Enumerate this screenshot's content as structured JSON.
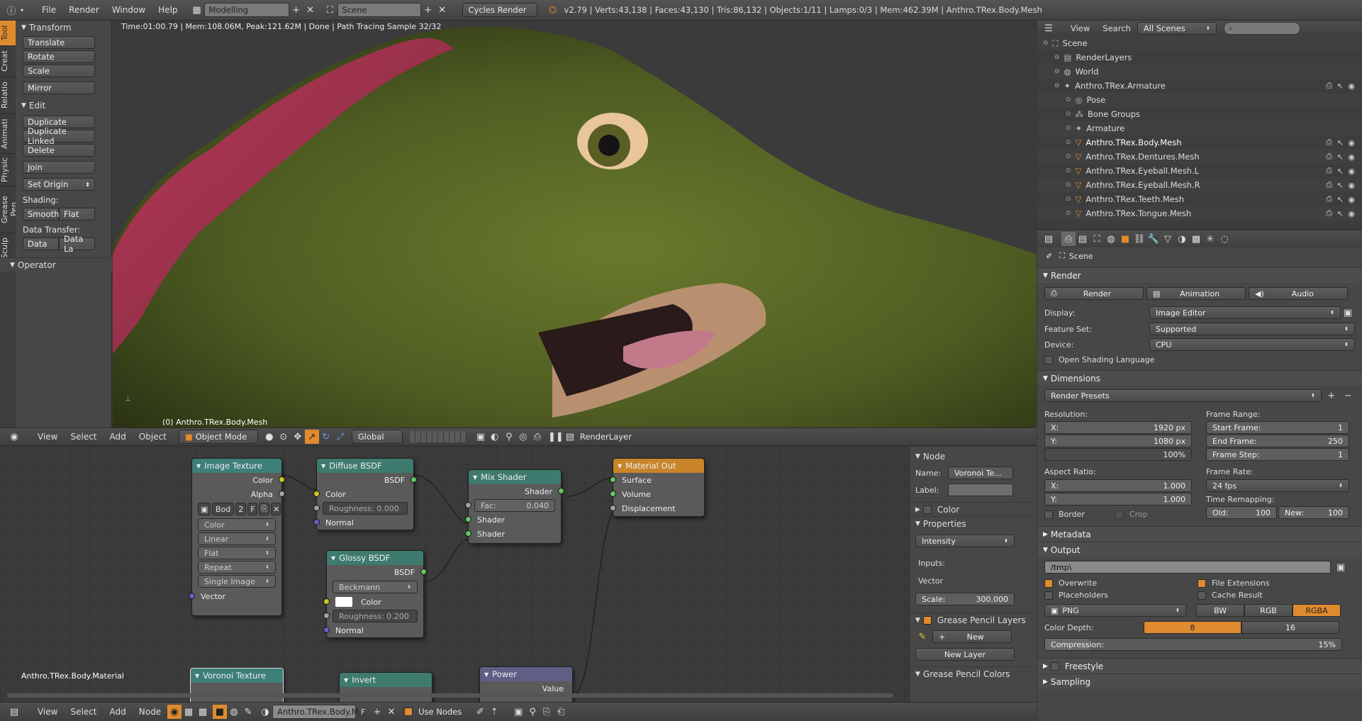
{
  "topbar": {
    "menus": [
      "File",
      "Render",
      "Window",
      "Help"
    ],
    "layout": "Modelling",
    "scene": "Scene",
    "engine": "Cycles Render",
    "stats": "v2.79 | Verts:43,138 | Faces:43,130 | Tris:86,132 | Objects:1/11 | Lamps:0/3 | Mem:462.39M | Anthro.TRex.Body.Mesh"
  },
  "toolshelf": {
    "tabs": [
      "Tool",
      "Creat",
      "Relatio",
      "Animati",
      "Physic",
      "Grease Pen",
      "Sculp"
    ],
    "transform_title": "Transform",
    "transform": [
      "Translate",
      "Rotate",
      "Scale",
      "Mirror"
    ],
    "edit_title": "Edit",
    "edit": [
      "Duplicate",
      "Duplicate Linked",
      "Delete",
      "Join"
    ],
    "set_origin": "Set Origin",
    "shading_label": "Shading:",
    "smooth": "Smooth",
    "flat": "Flat",
    "data_transfer_label": "Data Transfer:",
    "data": "Data",
    "data_la": "Data La",
    "operator": "Operator"
  },
  "viewport": {
    "render_status": "Time:01:00.79 | Mem:108.06M, Peak:121.62M | Done | Path Tracing Sample 32/32",
    "object_label": "(0) Anthro.TRex.Body.Mesh"
  },
  "vpheader": {
    "menus": [
      "View",
      "Select",
      "Add",
      "Object"
    ],
    "mode": "Object Mode",
    "pivot": "Global",
    "renderlayer": "RenderLayer"
  },
  "nodes": {
    "image_texture": {
      "title": "Image Texture",
      "out_color": "Color",
      "out_alpha": "Alpha",
      "img": "Bod",
      "users": "2",
      "fake": "F",
      "color_space": "Color",
      "interp": "Linear",
      "proj": "Flat",
      "ext": "Repeat",
      "source": "Single Image",
      "in_vector": "Vector"
    },
    "diffuse": {
      "title": "Diffuse BSDF",
      "out": "BSDF",
      "color": "Color",
      "roughness": "Roughness: 0.000",
      "normal": "Normal"
    },
    "mix": {
      "title": "Mix Shader",
      "out": "Shader",
      "fac": "Fac:",
      "fac_val": "0.040",
      "in1": "Shader",
      "in2": "Shader"
    },
    "output": {
      "title": "Material Out",
      "surface": "Surface",
      "volume": "Volume",
      "displacement": "Displacement"
    },
    "glossy": {
      "title": "Glossy BSDF",
      "out": "BSDF",
      "dist": "Beckmann",
      "color": "Color",
      "roughness": "Roughness: 0.200",
      "normal": "Normal"
    },
    "voronoi": {
      "title": "Voronoi Texture"
    },
    "invert": {
      "title": "Invert"
    },
    "power": {
      "title": "Power",
      "value": "Value"
    },
    "material_label": "Anthro.TRex.Body.Material"
  },
  "nodeprops": {
    "node_title": "Node",
    "name_label": "Name:",
    "name_val": "Voronoi Te...",
    "label_label": "Label:",
    "color": "Color",
    "properties": "Properties",
    "intensity": "Intensity",
    "inputs": "Inputs:",
    "vector": "Vector",
    "scale": "Scale:",
    "scale_val": "300.000",
    "gp_layers": "Grease Pencil Layers",
    "new": "New",
    "new_layer": "New Layer",
    "gp_colors": "Grease Pencil Colors"
  },
  "nodefoot": {
    "menus": [
      "View",
      "Select",
      "Add",
      "Node"
    ],
    "material": "Anthro.TRex.Body.M...",
    "fake": "F",
    "use_nodes": "Use Nodes"
  },
  "outliner": {
    "menus": [
      "View",
      "Search"
    ],
    "filter": "All Scenes",
    "rows": [
      {
        "name": "Scene",
        "indent": 0
      },
      {
        "name": "RenderLayers",
        "indent": 1
      },
      {
        "name": "World",
        "indent": 1
      },
      {
        "name": "Anthro.TRex.Armature",
        "indent": 1
      },
      {
        "name": "Pose",
        "indent": 2
      },
      {
        "name": "Bone Groups",
        "indent": 2
      },
      {
        "name": "Armature",
        "indent": 2
      },
      {
        "name": "Anthro.TRex.Body.Mesh",
        "indent": 2
      },
      {
        "name": "Anthro.TRex.Dentures.Mesh",
        "indent": 2
      },
      {
        "name": "Anthro.TRex.Eyeball.Mesh.L",
        "indent": 2
      },
      {
        "name": "Anthro.TRex.Eyeball.Mesh.R",
        "indent": 2
      },
      {
        "name": "Anthro.TRex.Teeth.Mesh",
        "indent": 2
      },
      {
        "name": "Anthro.TRex.Tongue.Mesh",
        "indent": 2
      }
    ]
  },
  "props": {
    "scene": "Scene",
    "render_title": "Render",
    "render_btn": "Render",
    "anim_btn": "Animation",
    "audio_btn": "Audio",
    "display_label": "Display:",
    "display_val": "Image Editor",
    "feature_label": "Feature Set:",
    "feature_val": "Supported",
    "device_label": "Device:",
    "device_val": "CPU",
    "osl": "Open Shading Language",
    "dimensions_title": "Dimensions",
    "render_presets": "Render Presets",
    "resolution": "Resolution:",
    "res_x_label": "X:",
    "res_x": "1920 px",
    "res_y_label": "Y:",
    "res_y": "1080 px",
    "res_pct": "100%",
    "frame_range": "Frame Range:",
    "start_label": "Start Frame:",
    "start": "1",
    "end_label": "End Frame:",
    "end": "250",
    "step_label": "Frame Step:",
    "step": "1",
    "aspect": "Aspect Ratio:",
    "asp_x_label": "X:",
    "asp_x": "1.000",
    "asp_y_label": "Y:",
    "asp_y": "1.000",
    "frame_rate": "Frame Rate:",
    "fps": "24 fps",
    "time_remap": "Time Remapping:",
    "old_label": "Old:",
    "old": "100",
    "new_label": "New:",
    "new": "100",
    "border": "Border",
    "crop": "Crop",
    "metadata_title": "Metadata",
    "output_title": "Output",
    "path": "/tmp\\",
    "overwrite": "Overwrite",
    "file_ext": "File Extensions",
    "placeholders": "Placeholders",
    "cache": "Cache Result",
    "format": "PNG",
    "bw": "BW",
    "rgb": "RGB",
    "rgba": "RGBA",
    "depth_label": "Color Depth:",
    "d8": "8",
    "d16": "16",
    "compression": "Compression:",
    "comp_val": "15%",
    "freestyle": "Freestyle",
    "sampling": "Sampling"
  }
}
